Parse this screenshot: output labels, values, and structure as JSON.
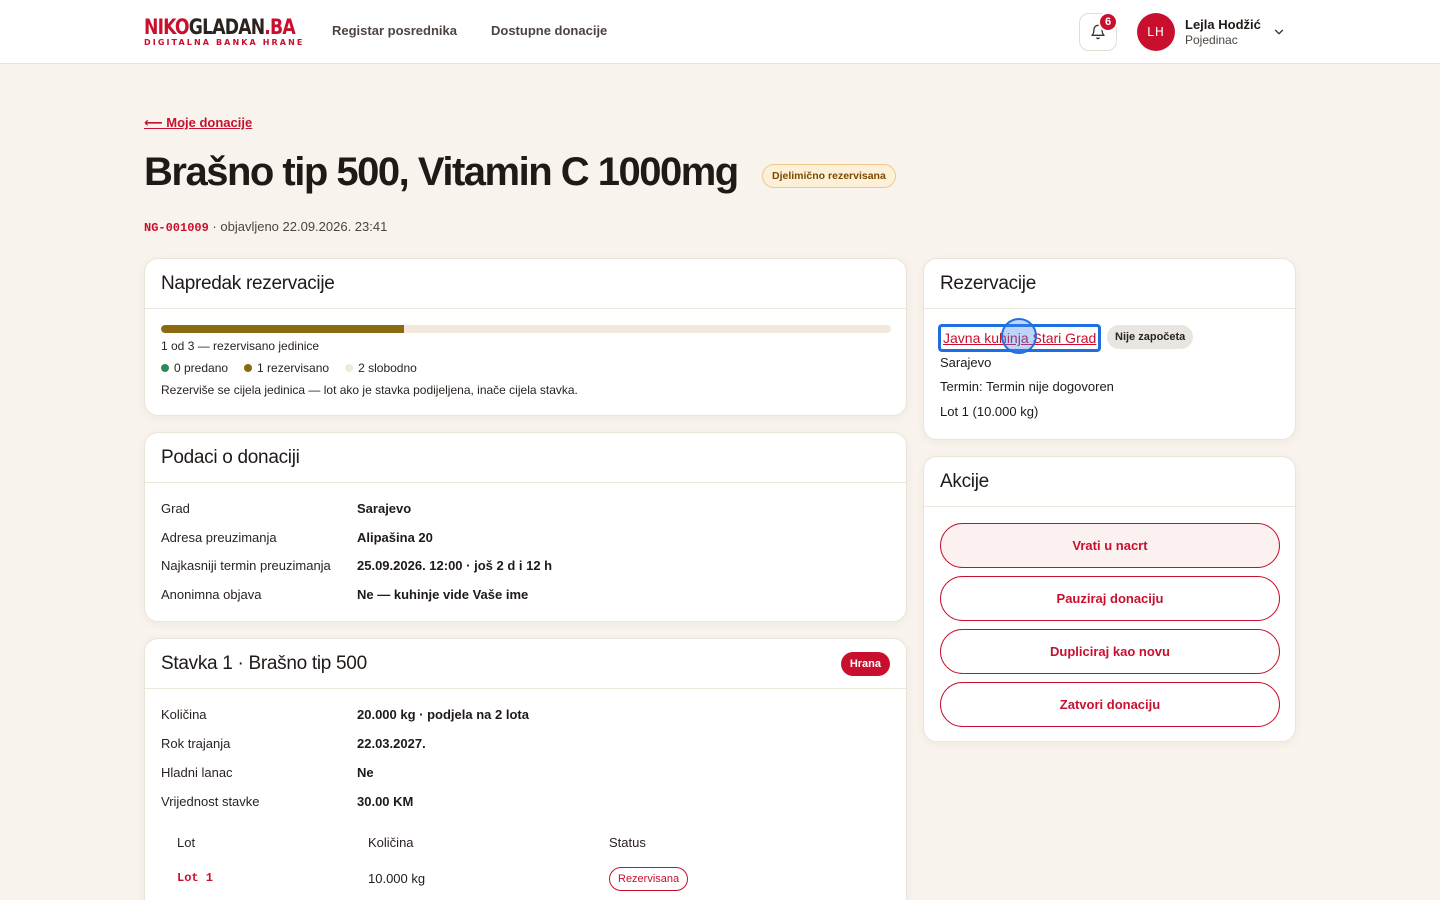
{
  "header": {
    "logo_a": "NIKO",
    "logo_b": "GLADAN",
    "logo_c": ".BA",
    "logo_sub": "DIGITALNA BANKA HRANE",
    "nav": [
      {
        "label": "Registar posrednika"
      },
      {
        "label": "Dostupne donacije"
      }
    ],
    "notifications_count": "6",
    "user": {
      "initials": "LH",
      "name": "Lejla Hodžić",
      "role": "Pojedinac"
    }
  },
  "page": {
    "back_label": "⟵ Moje donacije",
    "title": "Brašno tip 500, Vitamin C 1000mg",
    "status": "Djelimično rezervisana",
    "code": "NG-001009",
    "published": " · objavljeno 22.09.2026. 23:41"
  },
  "progress": {
    "title": "Napredak rezervacije",
    "reserved": 1,
    "total": 3,
    "caption": "1 od 3 — rezervisano jedinice",
    "legend": [
      {
        "label": "0 predano",
        "color": "#2e8b57"
      },
      {
        "label": "1 rezervisano",
        "color": "#8a6a10"
      },
      {
        "label": "2 slobodno",
        "color": "#f2e8dc"
      }
    ],
    "note": "Rezerviše se cijela jedinica — lot ako je stavka podijeljena, inače cijela stavka."
  },
  "details": {
    "title": "Podaci o donaciji",
    "rows": [
      {
        "k": "Grad",
        "v": "Sarajevo"
      },
      {
        "k": "Adresa preuzimanja",
        "v": "Alipašina 20"
      },
      {
        "k": "Najkasniji termin preuzimanja",
        "v": "25.09.2026. 12:00 · još 2 d i 12 h"
      },
      {
        "k": "Anonimna objava",
        "v": "Ne — kuhinje vide Vaše ime"
      }
    ]
  },
  "item": {
    "title": "Stavka 1 · Brašno tip 500",
    "badge": "Hrana",
    "rows": [
      {
        "k": "Količina",
        "v": "20.000 kg · podjela na 2 lota"
      },
      {
        "k": "Rok trajanja",
        "v": "22.03.2027."
      },
      {
        "k": "Hladni lanac",
        "v": "Ne"
      },
      {
        "k": "Vrijednost stavke",
        "v": "30.00 KM"
      }
    ],
    "lot_headers": [
      "Lot",
      "Količina",
      "Status"
    ],
    "lots": [
      {
        "lot": "Lot 1",
        "qty": "10.000 kg",
        "status": "Rezervisana"
      }
    ]
  },
  "reservations": {
    "title": "Rezervacije",
    "entries": [
      {
        "name": "Javna kuhinja Stari Grad",
        "status": "Nije započeta",
        "city": "Sarajevo",
        "term": "Termin: Termin nije dogovoren",
        "lot": "Lot 1 (10.000 kg)"
      }
    ]
  },
  "actions": {
    "title": "Akcije",
    "buttons": [
      {
        "label": "Vrati u nacrt"
      },
      {
        "label": "Pauziraj donaciju"
      },
      {
        "label": "Dupliciraj kao novu"
      },
      {
        "label": "Zatvori donaciju"
      }
    ]
  }
}
